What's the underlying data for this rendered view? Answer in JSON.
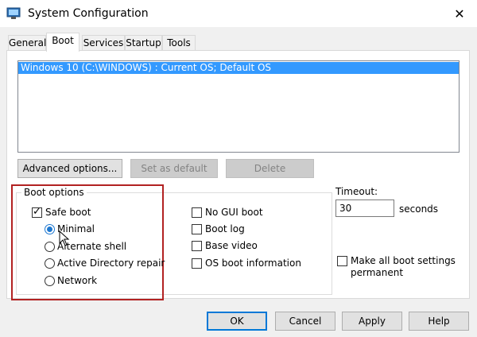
{
  "window": {
    "title": "System Configuration",
    "close": "✕"
  },
  "tabs": [
    {
      "label": "General"
    },
    {
      "label": "Boot"
    },
    {
      "label": "Services"
    },
    {
      "label": "Startup"
    },
    {
      "label": "Tools"
    }
  ],
  "os_list": {
    "selected": "Windows 10 (C:\\WINDOWS) : Current OS; Default OS"
  },
  "buttons": {
    "advanced": "Advanced options...",
    "set_default": "Set as default",
    "delete": "Delete",
    "ok": "OK",
    "cancel": "Cancel",
    "apply": "Apply",
    "help": "Help"
  },
  "boot_options": {
    "legend": "Boot options",
    "safe_boot": {
      "label": "Safe boot",
      "checked": true
    },
    "radios": [
      {
        "label": "Minimal",
        "selected": true
      },
      {
        "label": "Alternate shell",
        "selected": false
      },
      {
        "label": "Active Directory repair",
        "selected": false
      },
      {
        "label": "Network",
        "selected": false
      }
    ],
    "checks": [
      {
        "label": "No GUI boot",
        "checked": false
      },
      {
        "label": "Boot log",
        "checked": false
      },
      {
        "label": "Base video",
        "checked": false
      },
      {
        "label": "OS boot information",
        "checked": false
      }
    ]
  },
  "timeout": {
    "label": "Timeout:",
    "value": "30",
    "unit": "seconds"
  },
  "make_permanent": {
    "line1": "Make all boot settings",
    "line2": "permanent",
    "checked": false
  },
  "colors": {
    "selection": "#3399ff",
    "highlight_border": "#b22222",
    "default_button_border": "#0078d7"
  }
}
